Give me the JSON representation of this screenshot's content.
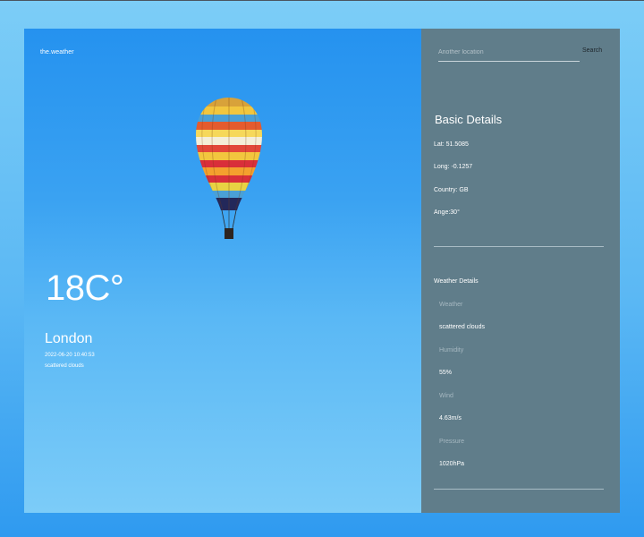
{
  "app": {
    "brand": "the.weather"
  },
  "current": {
    "temperature": "18C°",
    "city": "London",
    "datetime": "2022-06-20 10:40:53",
    "description": "scattered clouds"
  },
  "search": {
    "placeholder": "Another location",
    "button_label": "Search"
  },
  "basic_details": {
    "title": "Basic Details",
    "lat": "Lat: 51.5085",
    "long": "Long: -0.1257",
    "country": "Country: GB",
    "angle": "Ange:30°"
  },
  "weather_details": {
    "title": "Weather Details",
    "items": [
      {
        "label": "Weather",
        "value": "scattered clouds"
      },
      {
        "label": "Humidity",
        "value": "55%"
      },
      {
        "label": "Wind",
        "value": "4.63m/s"
      },
      {
        "label": "Pressure",
        "value": "1020hPa"
      }
    ]
  },
  "colors": {
    "panel_bg": "#607d8a",
    "hero_top": "#2592ef",
    "hero_bottom": "#7cccf8",
    "page_bg": "#5bb8f4"
  },
  "icons": [
    "hot-air-balloon-image"
  ]
}
